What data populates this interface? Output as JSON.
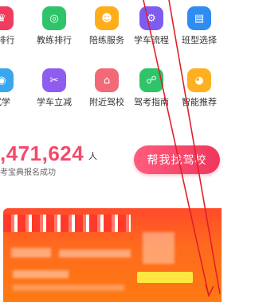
{
  "colors": {
    "accent": "#f24a6b",
    "button": "#f0365c",
    "banner": "#ff6a1e",
    "highlight": "#ffe640"
  },
  "row1": [
    {
      "label": "练排行",
      "icon": "trophy-icon",
      "color": "#f03c5e",
      "glyph": "♛"
    },
    {
      "label": "教练排行",
      "icon": "coach-medal-icon",
      "color": "#2fc46a",
      "glyph": "◎"
    },
    {
      "label": "陪练服务",
      "icon": "companion-icon",
      "color": "#ffae1a",
      "glyph": "☻"
    },
    {
      "label": "学车流程",
      "icon": "flow-icon",
      "color": "#7e5cf0",
      "glyph": "⚙"
    },
    {
      "label": "班型选择",
      "icon": "class-type-icon",
      "color": "#2f8cf0",
      "glyph": "▤"
    }
  ],
  "row2": [
    {
      "label": "试学",
      "icon": "trial-icon",
      "color": "#3aa6f0",
      "glyph": "◉"
    },
    {
      "label": "学车立减",
      "icon": "discount-icon",
      "color": "#8f5cf0",
      "glyph": "✂"
    },
    {
      "label": "附近驾校",
      "icon": "nearby-school-icon",
      "color": "#f26a78",
      "glyph": "⌂"
    },
    {
      "label": "驾考指南",
      "icon": "exam-guide-icon",
      "color": "#2fc46a",
      "glyph": "☍"
    },
    {
      "label": "智能推荐",
      "icon": "smart-recommend-icon",
      "color": "#ffb020",
      "glyph": "◕"
    }
  ],
  "stats": {
    "number": ",471,624",
    "unit": "人",
    "subtitle": "考宝典报名成功"
  },
  "cta": {
    "label": "帮我找驾校"
  }
}
